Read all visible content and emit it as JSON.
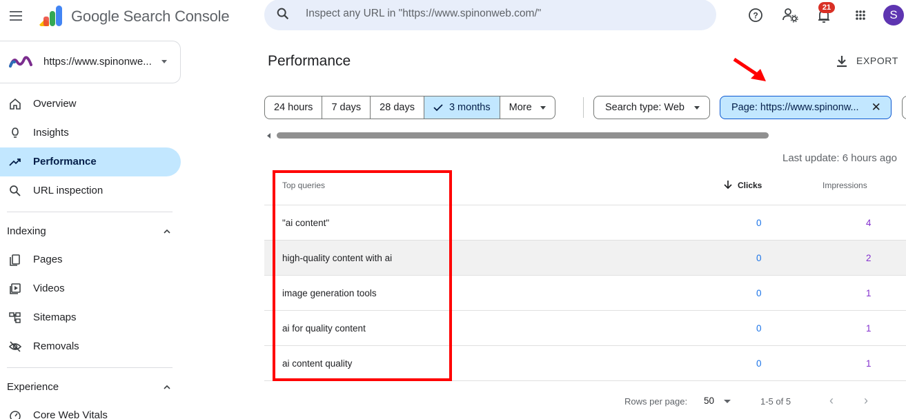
{
  "app": {
    "title": "Google Search Console"
  },
  "search": {
    "placeholder": "Inspect any URL in \"https://www.spinonweb.com/\""
  },
  "top_icons": {
    "help": "help-icon",
    "account_settings": "manage-account-icon",
    "notifications": "notifications-icon",
    "notifications_count": "21",
    "apps": "apps-grid-icon",
    "avatar_letter": "S"
  },
  "property": {
    "label": "https://www.spinonwe...",
    "icon": "property-logo-icon"
  },
  "sidebar": {
    "items": [
      {
        "label": "Overview",
        "icon": "home-icon"
      },
      {
        "label": "Insights",
        "icon": "lightbulb-icon"
      },
      {
        "label": "Performance",
        "icon": "trending-up-icon",
        "active": true
      },
      {
        "label": "URL inspection",
        "icon": "search-icon"
      }
    ],
    "indexing": {
      "heading": "Indexing",
      "items": [
        {
          "label": "Pages",
          "icon": "pages-icon"
        },
        {
          "label": "Videos",
          "icon": "video-icon"
        },
        {
          "label": "Sitemaps",
          "icon": "sitemap-icon"
        },
        {
          "label": "Removals",
          "icon": "removals-icon"
        }
      ]
    },
    "experience": {
      "heading": "Experience",
      "items": [
        {
          "label": "Core Web Vitals",
          "icon": "gauge-icon"
        }
      ]
    }
  },
  "main": {
    "title": "Performance",
    "export_label": "EXPORT",
    "date_chips": [
      "24 hours",
      "7 days",
      "28 days",
      "3 months",
      "More"
    ],
    "selected_date": "3 months",
    "search_type_chip": "Search type: Web",
    "page_filter_chip": "Page: https://www.spinonw...",
    "last_update": "Last update: 6 hours ago"
  },
  "table": {
    "headers": {
      "query": "Top queries",
      "clicks": "Clicks",
      "impressions": "Impressions"
    },
    "rows": [
      {
        "query": "\"ai content\"",
        "clicks": "0",
        "impressions": "4"
      },
      {
        "query": "high-quality content with ai",
        "clicks": "0",
        "impressions": "2"
      },
      {
        "query": "image generation tools",
        "clicks": "0",
        "impressions": "1"
      },
      {
        "query": "ai for quality content",
        "clicks": "0",
        "impressions": "1"
      },
      {
        "query": "ai content quality",
        "clicks": "0",
        "impressions": "1"
      }
    ],
    "footer": {
      "rows_per_page_label": "Rows per page:",
      "rows_per_page": "50",
      "range": "1-5 of 5"
    }
  },
  "colors": {
    "accent": "#c2e7ff",
    "clicks": "#1a73e8",
    "impressions": "#8430ce",
    "annotation": "#ff0000"
  }
}
